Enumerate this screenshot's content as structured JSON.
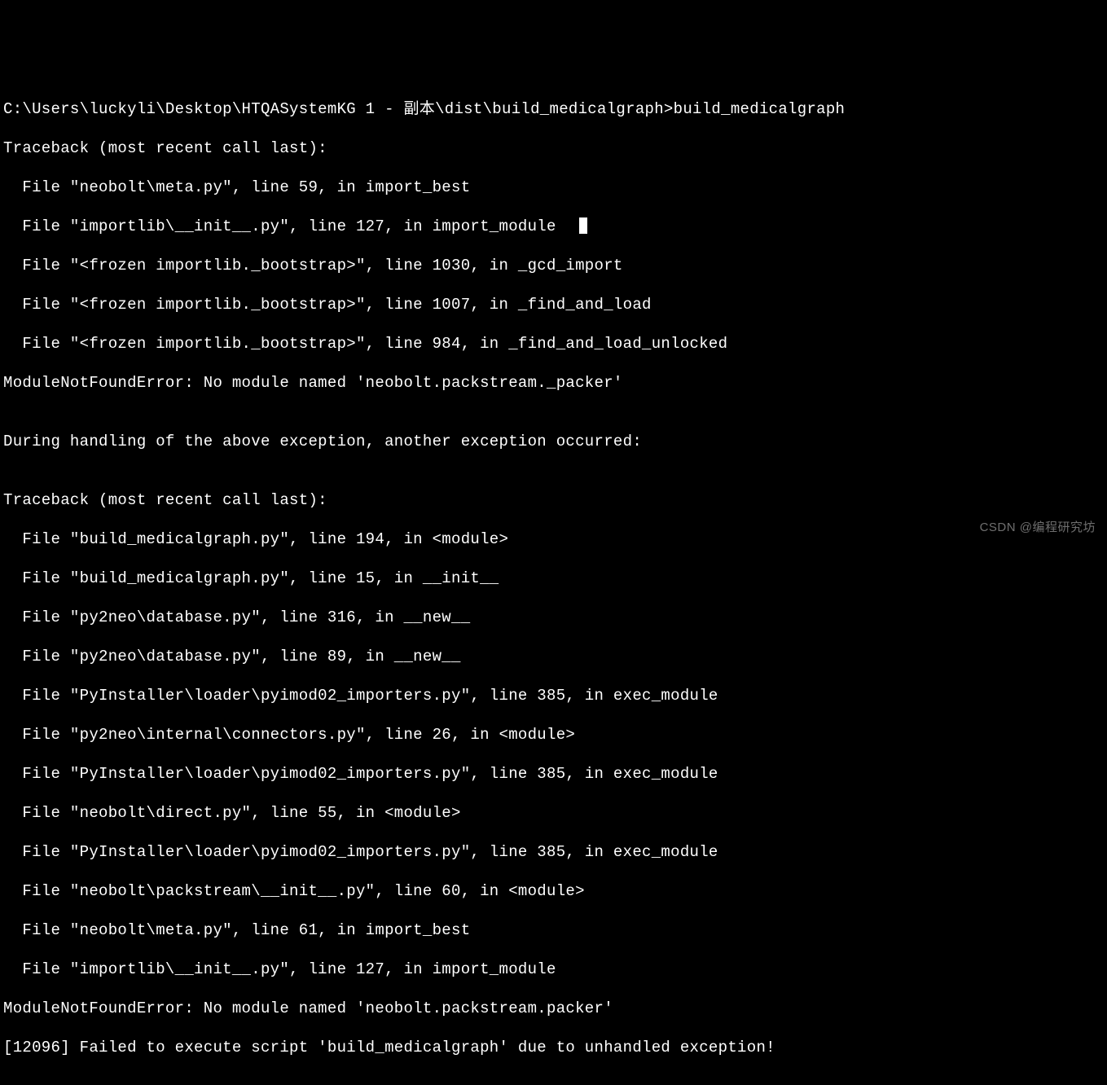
{
  "terminal": {
    "prompt_path": "C:\\Users\\luckyli\\Desktop\\HTQASystemKG 1 - 副本\\dist\\build_medicalgraph>",
    "command": "build_medicalgraph",
    "lines": [
      "Traceback (most recent call last):",
      "  File \"neobolt\\meta.py\", line 59, in import_best",
      "  File \"importlib\\__init__.py\", line 127, in import_module",
      "  File \"<frozen importlib._bootstrap>\", line 1030, in _gcd_import",
      "  File \"<frozen importlib._bootstrap>\", line 1007, in _find_and_load",
      "  File \"<frozen importlib._bootstrap>\", line 984, in _find_and_load_unlocked",
      "ModuleNotFoundError: No module named 'neobolt.packstream._packer'",
      "",
      "During handling of the above exception, another exception occurred:",
      "",
      "Traceback (most recent call last):",
      "  File \"build_medicalgraph.py\", line 194, in <module>",
      "  File \"build_medicalgraph.py\", line 15, in __init__",
      "  File \"py2neo\\database.py\", line 316, in __new__",
      "  File \"py2neo\\database.py\", line 89, in __new__",
      "  File \"PyInstaller\\loader\\pyimod02_importers.py\", line 385, in exec_module",
      "  File \"py2neo\\internal\\connectors.py\", line 26, in <module>",
      "  File \"PyInstaller\\loader\\pyimod02_importers.py\", line 385, in exec_module",
      "  File \"neobolt\\direct.py\", line 55, in <module>",
      "  File \"PyInstaller\\loader\\pyimod02_importers.py\", line 385, in exec_module",
      "  File \"neobolt\\packstream\\__init__.py\", line 60, in <module>",
      "  File \"neobolt\\meta.py\", line 61, in import_best",
      "  File \"importlib\\__init__.py\", line 127, in import_module",
      "ModuleNotFoundError: No module named 'neobolt.packstream.packer'",
      "[12096] Failed to execute script 'build_medicalgraph' due to unhandled exception!"
    ],
    "cursor_line_index": 2
  },
  "watermark": "CSDN @编程研究坊"
}
